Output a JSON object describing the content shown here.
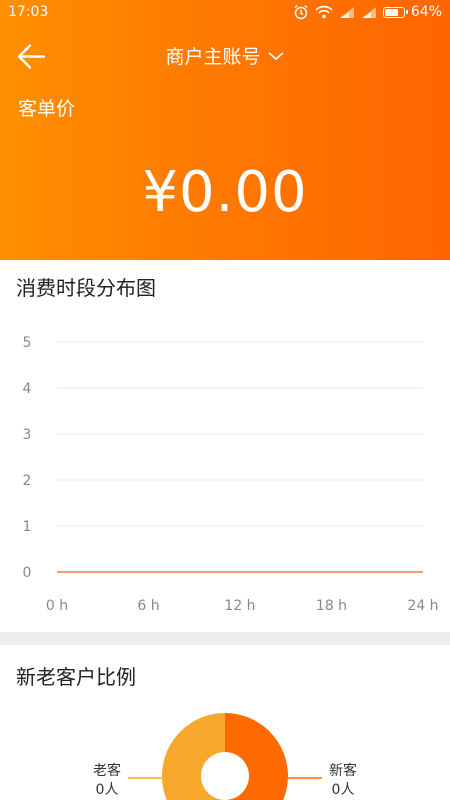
{
  "status_bar": {
    "time": "17:03",
    "battery": "64%",
    "battery_level": 0.64
  },
  "header": {
    "account_title": "商户主账号",
    "metric_label": "客单价",
    "metric_value": "¥0.00"
  },
  "time_chart": {
    "title": "消费时段分布图",
    "chart_data": {
      "type": "line",
      "x_ticks": [
        "0 h",
        "6 h",
        "12 h",
        "18 h",
        "24 h"
      ],
      "y_ticks": [
        "0",
        "1",
        "2",
        "3",
        "4",
        "5"
      ],
      "ylim": [
        0,
        5
      ],
      "xlim": [
        0,
        24
      ],
      "grid": true,
      "series": [
        {
          "color": "#f07a3a",
          "x": [
            0,
            24
          ],
          "y": [
            0,
            0
          ]
        }
      ]
    }
  },
  "customer_ratio": {
    "title": "新老客户比例",
    "chart_data": {
      "type": "pie",
      "slices": [
        {
          "name": "老客",
          "value_label": "0人",
          "value": 0,
          "color": "#f7a72b"
        },
        {
          "name": "新客",
          "value_label": "0人",
          "value": 0,
          "color": "#ff6a00"
        }
      ]
    }
  }
}
